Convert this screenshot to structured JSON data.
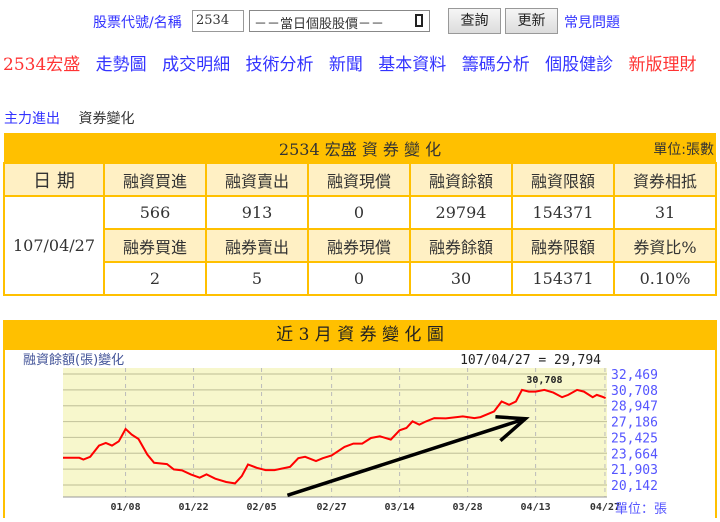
{
  "search": {
    "label": "股票代號/名稱",
    "input_value": "2534",
    "select_value": "－－當日個股股價－－",
    "query_button": "查詢",
    "update_button": "更新",
    "faq_link": "常見問題"
  },
  "nav": {
    "stock": "2534宏盛",
    "items": [
      "走勢圖",
      "成交明細",
      "技術分析",
      "新聞",
      "基本資料",
      "籌碼分析",
      "個股健診"
    ],
    "promo": "新版理財"
  },
  "subnav": {
    "link": "主力進出",
    "current": "資券變化"
  },
  "table": {
    "title": "2534 宏盛 資 券 變 化",
    "unit": "單位:張數",
    "date_header": "日 期",
    "date": "107/04/27",
    "margin_headers": [
      "融資買進",
      "融資賣出",
      "融資現償",
      "融資餘額",
      "融資限額",
      "資券相抵"
    ],
    "margin_values": [
      "566",
      "913",
      "0",
      "29794",
      "154371",
      "31"
    ],
    "short_headers": [
      "融券買進",
      "融券賣出",
      "融券現償",
      "融券餘額",
      "融券限額",
      "券資比%"
    ],
    "short_values": [
      "2",
      "5",
      "0",
      "30",
      "154371",
      "0.10%"
    ]
  },
  "chart_section": {
    "title": "近 3 月 資 券 變 化 圖"
  },
  "chart_data": {
    "type": "line",
    "title": "融資餘額(張)變化",
    "annotation": "107/04/27 = 29,794",
    "peak_label": "30,708",
    "unit_label": "單位：張",
    "ylim": [
      19500,
      33200
    ],
    "xlim": [
      0,
      80
    ],
    "yticks": [
      "32,469",
      "30,708",
      "28,947",
      "27,186",
      "25,425",
      "23,664",
      "21,903",
      "20,142"
    ],
    "ytick_values": [
      32469,
      30708,
      28947,
      27186,
      25425,
      23664,
      21903,
      20142
    ],
    "xticks": [
      "01/08",
      "01/22",
      "02/05",
      "02/27",
      "03/14",
      "03/28",
      "04/13",
      "04/27"
    ],
    "xtick_values": [
      9.2,
      19.2,
      29.2,
      39.5,
      49.5,
      59.5,
      69.5,
      79.7
    ],
    "series": [
      {
        "name": "融資餘額",
        "color": "#ff0000",
        "points": [
          [
            0,
            23159
          ],
          [
            2.4,
            23159
          ],
          [
            3,
            22975
          ],
          [
            4,
            23269
          ],
          [
            5.3,
            24520
          ],
          [
            6.3,
            24815
          ],
          [
            7.2,
            24520
          ],
          [
            8.2,
            24999
          ],
          [
            9.2,
            26360
          ],
          [
            10.1,
            25735
          ],
          [
            11.1,
            25256
          ],
          [
            12.4,
            23527
          ],
          [
            13.4,
            22607
          ],
          [
            15.3,
            22459
          ],
          [
            16.3,
            21871
          ],
          [
            17.5,
            21760
          ],
          [
            18.8,
            21319
          ],
          [
            20.1,
            20951
          ],
          [
            21.1,
            21319
          ],
          [
            22.4,
            20840
          ],
          [
            24,
            20473
          ],
          [
            25.3,
            20325
          ],
          [
            26.3,
            21135
          ],
          [
            27.2,
            22423
          ],
          [
            28.5,
            22055
          ],
          [
            29.8,
            21797
          ],
          [
            31.1,
            21797
          ],
          [
            33.4,
            22165
          ],
          [
            34.6,
            23122
          ],
          [
            35.6,
            23269
          ],
          [
            37.2,
            22791
          ],
          [
            38.2,
            23122
          ],
          [
            39.5,
            23416
          ],
          [
            41.4,
            24373
          ],
          [
            42.7,
            24741
          ],
          [
            44,
            24741
          ],
          [
            45.3,
            25366
          ],
          [
            46.6,
            25550
          ],
          [
            48.2,
            25182
          ],
          [
            49.5,
            26213
          ],
          [
            50.5,
            26471
          ],
          [
            51.4,
            27207
          ],
          [
            52.4,
            26839
          ],
          [
            53.4,
            27207
          ],
          [
            54.6,
            27575
          ],
          [
            56.3,
            27538
          ],
          [
            57.9,
            27685
          ],
          [
            58.8,
            27759
          ],
          [
            60.5,
            27575
          ],
          [
            61.4,
            27685
          ],
          [
            63.4,
            28311
          ],
          [
            64.5,
            29415
          ],
          [
            65.6,
            29047
          ],
          [
            66.6,
            29415
          ],
          [
            67.5,
            30703
          ],
          [
            68.5,
            30519
          ],
          [
            69.5,
            30519
          ],
          [
            70.8,
            30708
          ],
          [
            72.1,
            30408
          ],
          [
            73.4,
            29893
          ],
          [
            74.3,
            30151
          ],
          [
            75.6,
            30700
          ],
          [
            76.6,
            30519
          ],
          [
            77.9,
            29893
          ],
          [
            78.5,
            30151
          ],
          [
            79.2,
            29967
          ],
          [
            79.8,
            29794
          ]
        ]
      }
    ],
    "arrow": {
      "from": [
        33,
        19000
      ],
      "to": [
        68,
        27500
      ],
      "color": "#000000"
    }
  }
}
